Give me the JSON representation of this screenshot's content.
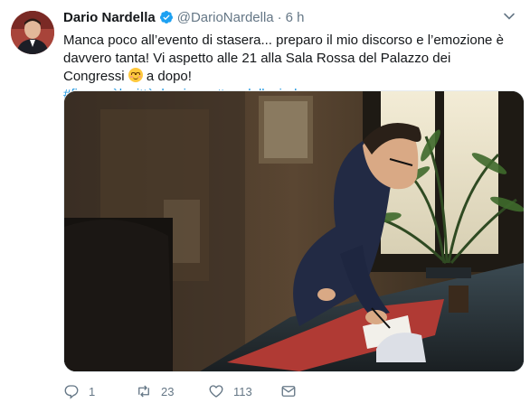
{
  "tweet": {
    "author_name": "Dario Nardella",
    "handle": "@DarioNardella",
    "separator": "·",
    "time": "6 h",
    "text_before_emoji": "Manca poco all’evento di stasera... preparo il mio discorso e l’emozione è davvero tanta! Vi aspetto alle 21 alla Sala Rossa del Palazzo dei Congressi",
    "text_after_emoji": "a dopo!",
    "hashtags": [
      "#firenzeèlacittàchesiamo",
      "#nardellasindaco"
    ],
    "emoji": "smiling-face-with-smiling-eyes"
  },
  "actions": {
    "reply_count": "1",
    "retweet_count": "23",
    "like_count": "113"
  },
  "colors": {
    "link": "#1b95e0",
    "secondary_text": "#657786",
    "verified": "#1da1f2"
  }
}
